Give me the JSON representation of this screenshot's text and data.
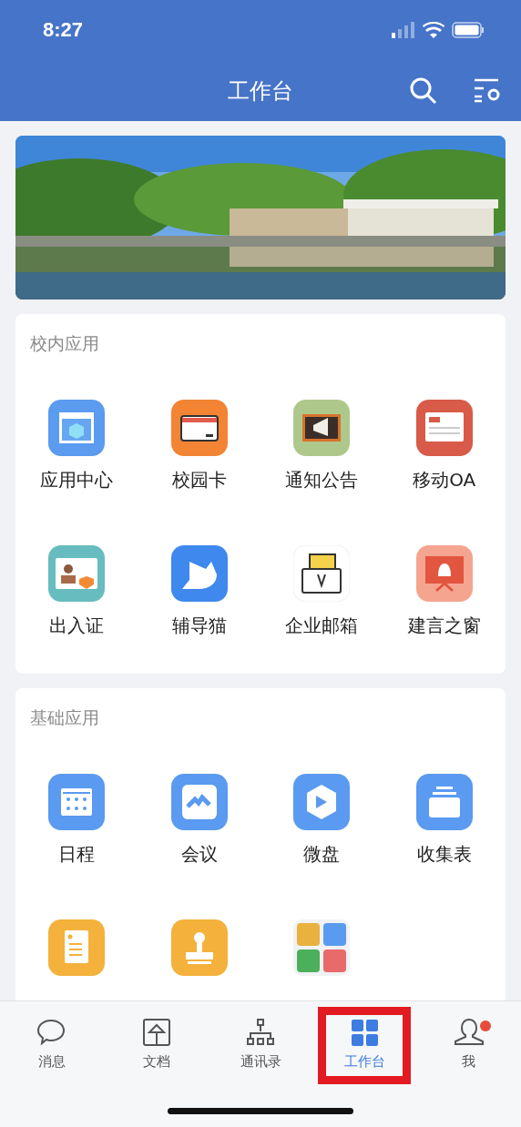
{
  "status_bar": {
    "time": "8:27"
  },
  "header": {
    "title": "工作台"
  },
  "sections": [
    {
      "title": "校内应用",
      "apps": [
        {
          "kind": "app",
          "label": "应用中心"
        },
        {
          "kind": "app",
          "label": "校园卡"
        },
        {
          "kind": "app",
          "label": "通知公告"
        },
        {
          "kind": "app",
          "label": "移动OA"
        },
        {
          "kind": "app",
          "label": "出入证"
        },
        {
          "kind": "app",
          "label": "辅导猫"
        },
        {
          "kind": "app",
          "label": "企业邮箱"
        },
        {
          "kind": "app",
          "label": "建言之窗"
        }
      ]
    },
    {
      "title": "基础应用",
      "apps": [
        {
          "kind": "app",
          "label": "日程"
        },
        {
          "kind": "app",
          "label": "会议"
        },
        {
          "kind": "app",
          "label": "微盘"
        },
        {
          "kind": "app",
          "label": "收集表"
        },
        {
          "kind": "icon_only"
        },
        {
          "kind": "icon_only"
        },
        {
          "kind": "icon_only"
        }
      ]
    }
  ],
  "tab_bar": [
    {
      "label": "消息",
      "selected": false,
      "highlighted": false,
      "badge": false
    },
    {
      "label": "文档",
      "selected": false,
      "highlighted": false,
      "badge": false
    },
    {
      "label": "通讯录",
      "selected": false,
      "highlighted": false,
      "badge": false
    },
    {
      "label": "工作台",
      "selected": true,
      "highlighted": true,
      "badge": false
    },
    {
      "label": "我",
      "selected": false,
      "highlighted": false,
      "badge": true
    }
  ]
}
